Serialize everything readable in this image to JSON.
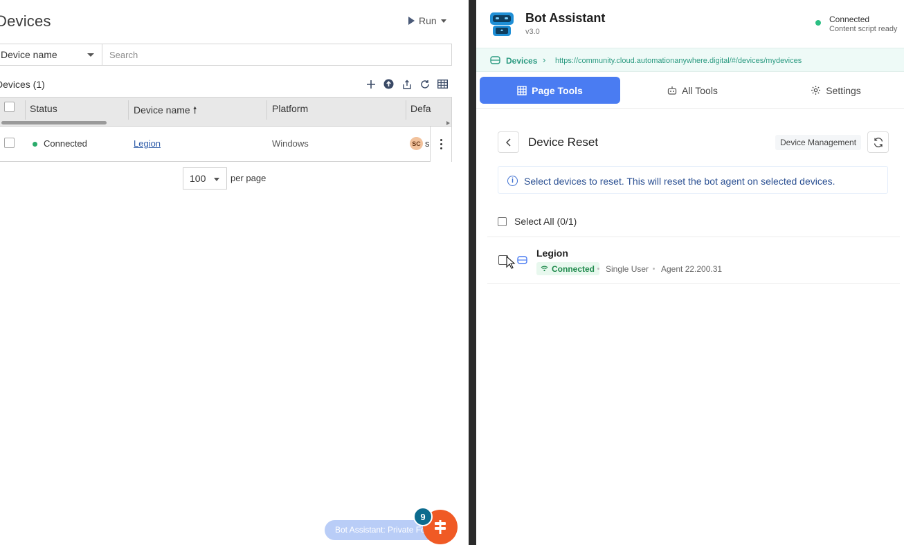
{
  "left": {
    "title": "Devices",
    "run_label": "Run",
    "filter_field": "Device name",
    "search_placeholder": "Search",
    "count_label": "Devices (1)",
    "columns": [
      "Status",
      "Device name",
      "Platform",
      "Defa"
    ],
    "rows": [
      {
        "status": "Connected",
        "device_name": "Legion",
        "platform": "Windows",
        "default_avatar": "SC",
        "default_text": "s"
      }
    ],
    "per_page_value": "100",
    "per_page_label": "per page",
    "toast_text": "Bot Assistant: Private Fo",
    "fab_badge": "9"
  },
  "panel": {
    "title": "Bot Assistant",
    "version": "v3.0",
    "status_title": "Connected",
    "status_sub": "Content script ready",
    "status_color": "#2bbf83",
    "url_crumb": "Devices",
    "url": "https://community.cloud.automationanywhere.digital/#/devices/mydevices",
    "tabs": [
      {
        "label": "Page Tools",
        "active": true
      },
      {
        "label": "All Tools",
        "active": false
      },
      {
        "label": "Settings",
        "active": false
      }
    ],
    "accent_color": "#4a7cf2",
    "section_title": "Device Reset",
    "section_badge": "Device Management",
    "info_text": "Select devices to reset. This will reset the bot agent on selected devices.",
    "select_all": "Select All (0/1)",
    "devices": [
      {
        "name": "Legion",
        "status": "Connected",
        "user_mode": "Single User",
        "agent": "Agent 22.200.31"
      }
    ]
  }
}
